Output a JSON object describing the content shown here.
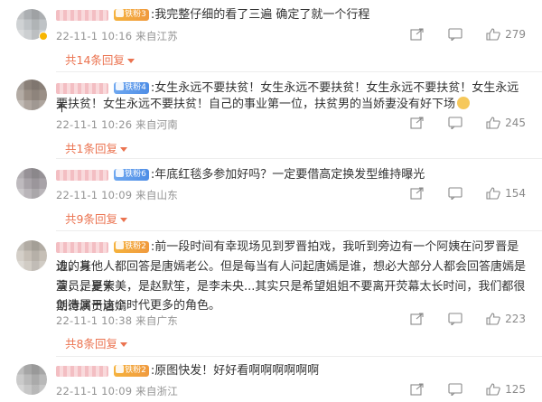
{
  "comments": [
    {
      "badge": "铁粉3",
      "badge_color": "gold",
      "text": ":我完整仔细的看了三遍  确定了就一个行程",
      "date": "22-11-1 10:16",
      "location": "来自江苏",
      "likes": "279",
      "replies": "共14条回复"
    },
    {
      "badge": "铁粉4",
      "badge_color": "blue",
      "text_line1": ":女生永远不要扶贫！女生永远不要扶贫！女生永远不要扶贫！女生永远不",
      "text_line2": "要扶贫！女生永远不要扶贫！自己的事业第一位，扶贫男的当娇妻没有好下场",
      "date": "22-11-1 10:26",
      "location": "来自河南",
      "likes": "245",
      "replies": "共1条回复"
    },
    {
      "badge": "铁粉6",
      "badge_color": "blue",
      "text": ":年底红毯多参加好吗？一定要借高定换发型维持曝光",
      "date": "22-11-1 10:09",
      "location": "来自山东",
      "likes": "154",
      "replies": "共9条回复"
    },
    {
      "badge": "铁粉2",
      "badge_color": "gold",
      "text_line1": ":前一段时间有幸现场见到罗晋拍戏，我听到旁边有一个阿姨在问罗晋是谁，身",
      "text_line2": "边的其他人都回答是唐嫣老公。但是每当有人问起唐嫣是谁，想必大部分人都会回答唐嫣是演员，是紫",
      "text_line3": "萱，是夏天美，是赵默笙，是李未央...其实只是希望姐姐不要离开荧幕太长时间，我们都很期待演员唐嫣",
      "text_line4": "创造属于这个时代更多的角色。",
      "date": "22-11-1 10:38",
      "location": "来自广东",
      "likes": "223",
      "replies": "共8条回复"
    },
    {
      "badge": "铁粉2",
      "badge_color": "gold",
      "text": ":原图快发！好好看啊啊啊啊啊啊",
      "date": "22-11-1 10:09",
      "location": "来自浙江",
      "likes": "125"
    }
  ]
}
